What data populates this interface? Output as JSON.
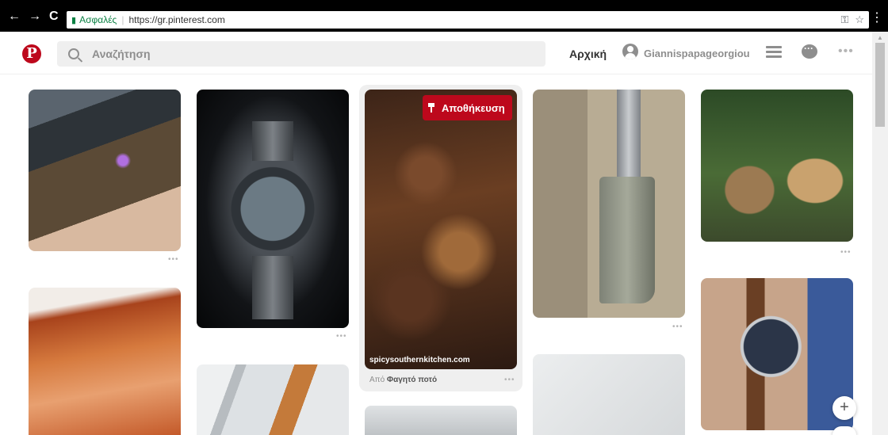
{
  "browser": {
    "back_icon": "←",
    "forward_icon": "→",
    "reload_icon": "C",
    "secure_label": "Ασφαλές",
    "url": "https://gr.pinterest.com",
    "key_icon": "key-icon",
    "star_icon": "☆",
    "menu_icon": "⋮"
  },
  "header": {
    "logo": "P",
    "search_placeholder": "Αναζήτηση",
    "home_label": "Αρχική",
    "username": "Giannispapageorgiou",
    "more_label": "•••"
  },
  "pins": {
    "dots": "•••",
    "featured": {
      "save_label": "Αποθήκευση",
      "domain": "spicysouthernkitchen.com",
      "source_prefix": "Από",
      "source_board": "Φαγητό ποτό",
      "dots": "•••"
    }
  },
  "fab": {
    "add_label": "+"
  },
  "colors": {
    "brand": "#bd081c",
    "secure": "#0b8043",
    "muted": "#8e8e8e"
  }
}
